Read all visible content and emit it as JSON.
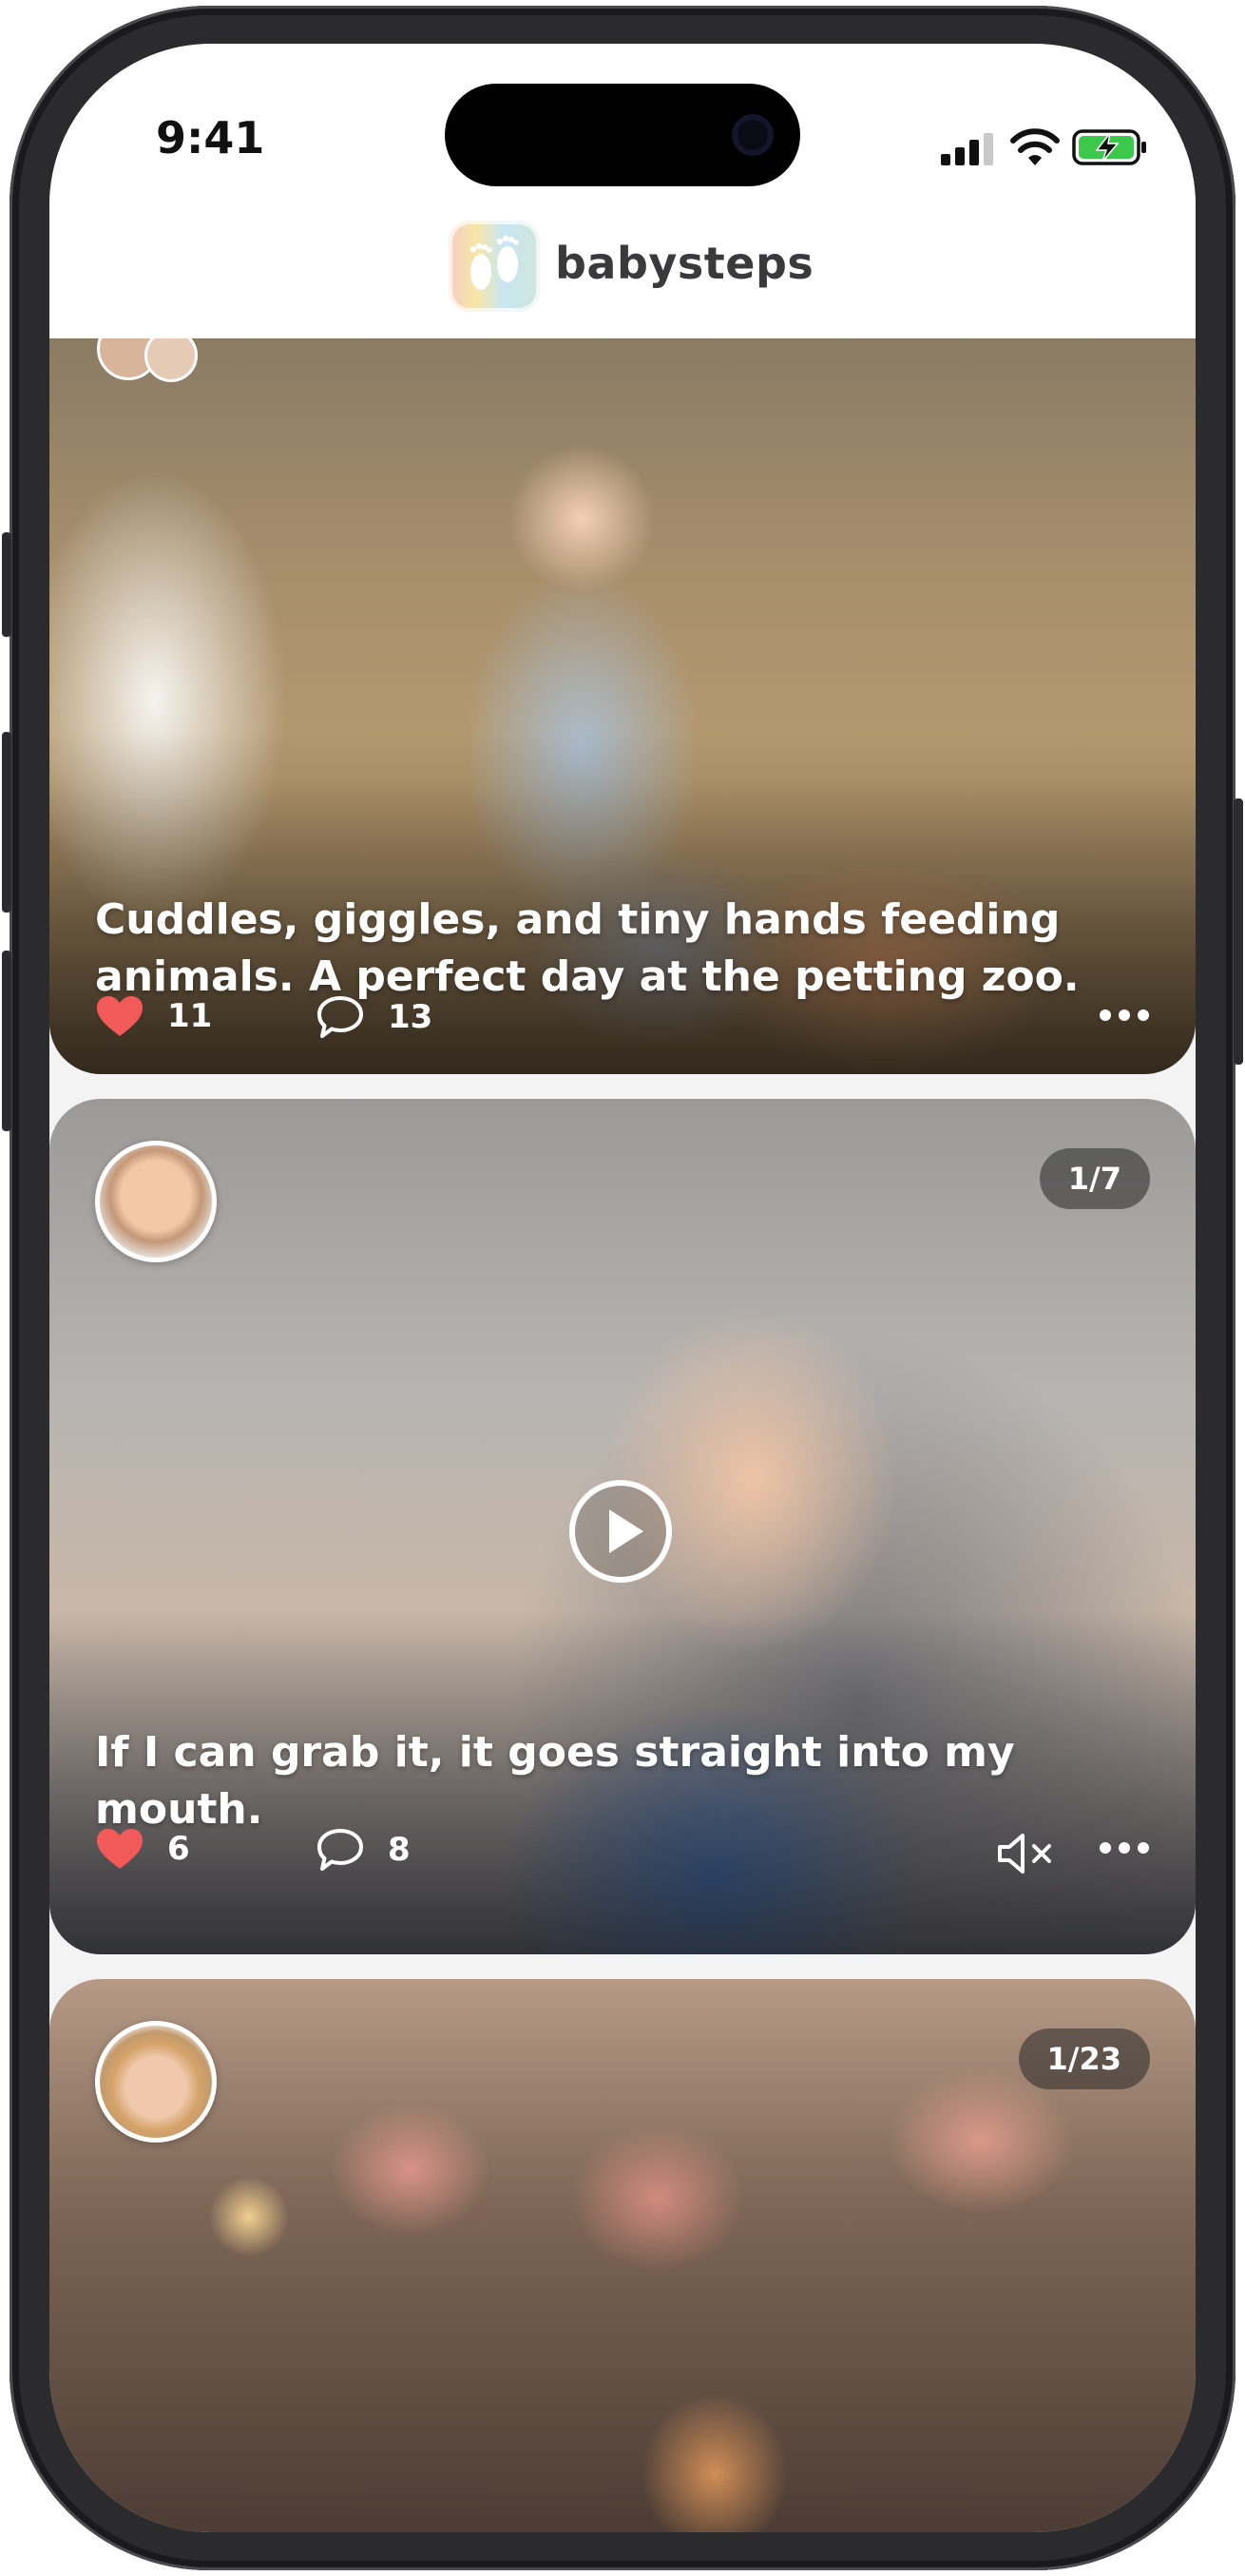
{
  "status_bar": {
    "time": "9:41"
  },
  "header": {
    "brand": "babysteps"
  },
  "posts": [
    {
      "caption": "Cuddles, giggles, and tiny hands feeding animals. A perfect day at the petting zoo.",
      "likes": "11",
      "comments": "13"
    },
    {
      "caption": "If I can grab it, it goes straight into my mouth.",
      "likes": "6",
      "comments": "8",
      "counter": "1/7",
      "media": "video"
    },
    {
      "counter": "1/23"
    }
  ],
  "icons": {
    "like": "heart-icon",
    "comment": "comment-bubble-icon",
    "more": "more-dots-icon",
    "mute": "speaker-muted-icon",
    "play": "play-icon"
  },
  "colors": {
    "like": "#f25a5a",
    "brand_text": "#3a3a3c",
    "battery": "#3cc84b"
  }
}
